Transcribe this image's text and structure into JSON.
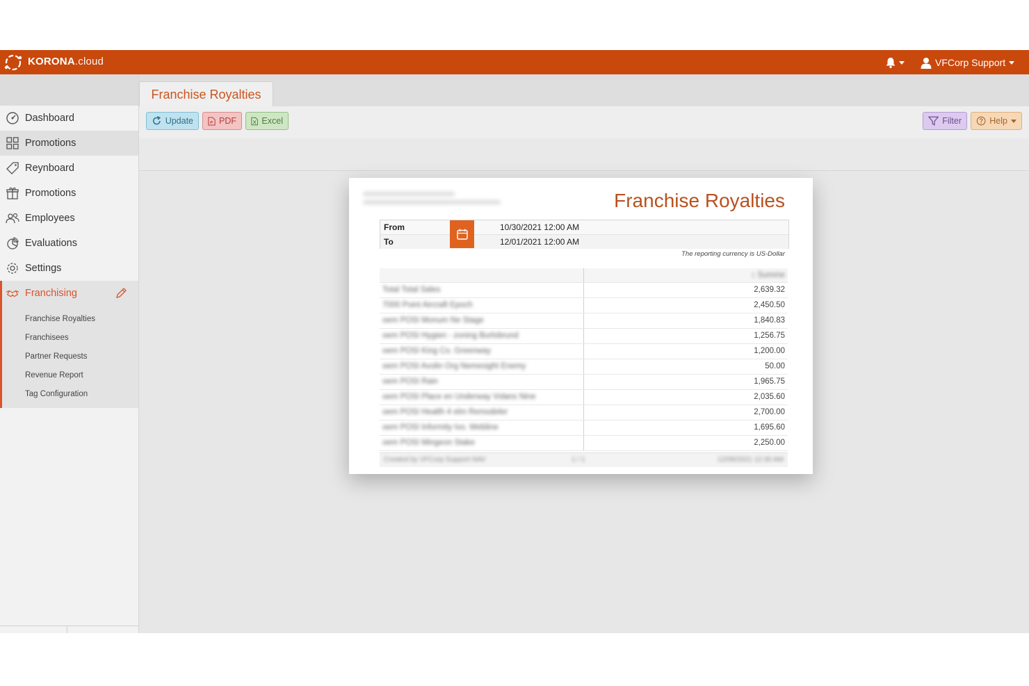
{
  "app": {
    "brand_bold": "KORONA",
    "brand_light": ".cloud",
    "user_name": "VFCorp Support",
    "accent": "#c9480c"
  },
  "sidebar": {
    "items": [
      {
        "label": "Dashboard",
        "icon": "dashboard-icon"
      },
      {
        "label": "Promotions",
        "icon": "grid-icon"
      },
      {
        "label": "Reynboard",
        "icon": "tag-icon"
      },
      {
        "label": "Promotions",
        "icon": "gift-icon"
      },
      {
        "label": "Employees",
        "icon": "users-icon"
      },
      {
        "label": "Evaluations",
        "icon": "pie-chart-icon"
      },
      {
        "label": "Settings",
        "icon": "gear-icon"
      },
      {
        "label": "Franchising",
        "icon": "handshake-icon"
      }
    ],
    "subitems": [
      "Franchise Royalties",
      "Franchisees",
      "Partner Requests",
      "Revenue Report",
      "Tag Configuration"
    ]
  },
  "tab": {
    "label": "Franchise Royalties"
  },
  "toolbar": {
    "update": "Update",
    "pdf": "PDF",
    "excel": "Excel",
    "filter": "Filter",
    "help": "Help"
  },
  "report": {
    "title": "Franchise Royalties",
    "from_label": "From",
    "from_value": "10/30/2021 12:00 AM",
    "to_label": "To",
    "to_value": "12/01/2021 12:00 AM",
    "currency_note": "The reporting currency is US-Dollar",
    "column_header": "↕ Summe",
    "rows": [
      {
        "name": "Total Total Sales",
        "value": "2,639.32"
      },
      {
        "name": "7000 Point Aircraft Epoch",
        "value": "2,450.50"
      },
      {
        "name": "oem POSI Monum Ne Stage",
        "value": "1,840.83"
      },
      {
        "name": "oem POSI Hygien - zoning Burlobrund",
        "value": "1,256.75"
      },
      {
        "name": "oem POSI King Co. Greenway",
        "value": "1,200.00"
      },
      {
        "name": "oem POSI Avolin Org Nemesight Enemy",
        "value": "50.00"
      },
      {
        "name": "oem POSI Rain",
        "value": "1,965.75"
      },
      {
        "name": "oem POSI Place en Underway Volans Nine",
        "value": "2,035.60"
      },
      {
        "name": "oem POSI Health 4 elm Remodeler",
        "value": "2,700.00"
      },
      {
        "name": "oem POSI Informity Ivo. Webline",
        "value": "1,695.60"
      },
      {
        "name": "oem POSI Mingeon Stake",
        "value": "2,250.00"
      }
    ],
    "footer_left": "Created by VFCorp Support NAV",
    "footer_mid": "1 / 1",
    "footer_right": "12/08/2021 12:30 AM"
  }
}
